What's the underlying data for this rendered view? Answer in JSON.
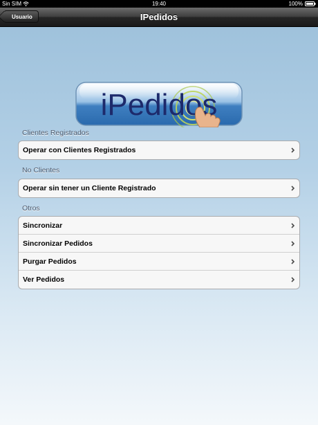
{
  "status_bar": {
    "carrier": "Sin SIM",
    "time": "19:40",
    "battery": "100%"
  },
  "navbar": {
    "back_label": "Usuario",
    "title": "IPedidos"
  },
  "logo": {
    "text": "iPedidos"
  },
  "sections": [
    {
      "header": "Clientes Registrados",
      "items": [
        {
          "label": "Operar con Clientes Registrados"
        }
      ]
    },
    {
      "header": "No Clientes",
      "items": [
        {
          "label": "Operar sin tener un Cliente Registrado"
        }
      ]
    },
    {
      "header": "Otros",
      "items": [
        {
          "label": "Sincronizar"
        },
        {
          "label": "Sincronizar Pedidos"
        },
        {
          "label": "Purgar Pedidos"
        },
        {
          "label": "Ver Pedidos"
        }
      ]
    }
  ],
  "colors": {
    "navbar": "#2b2b2b",
    "background_top": "#9fc2dc",
    "background_bottom": "#f4f8fb",
    "section_header": "#4c5a6e",
    "logo_text": "#1d2a6b"
  }
}
